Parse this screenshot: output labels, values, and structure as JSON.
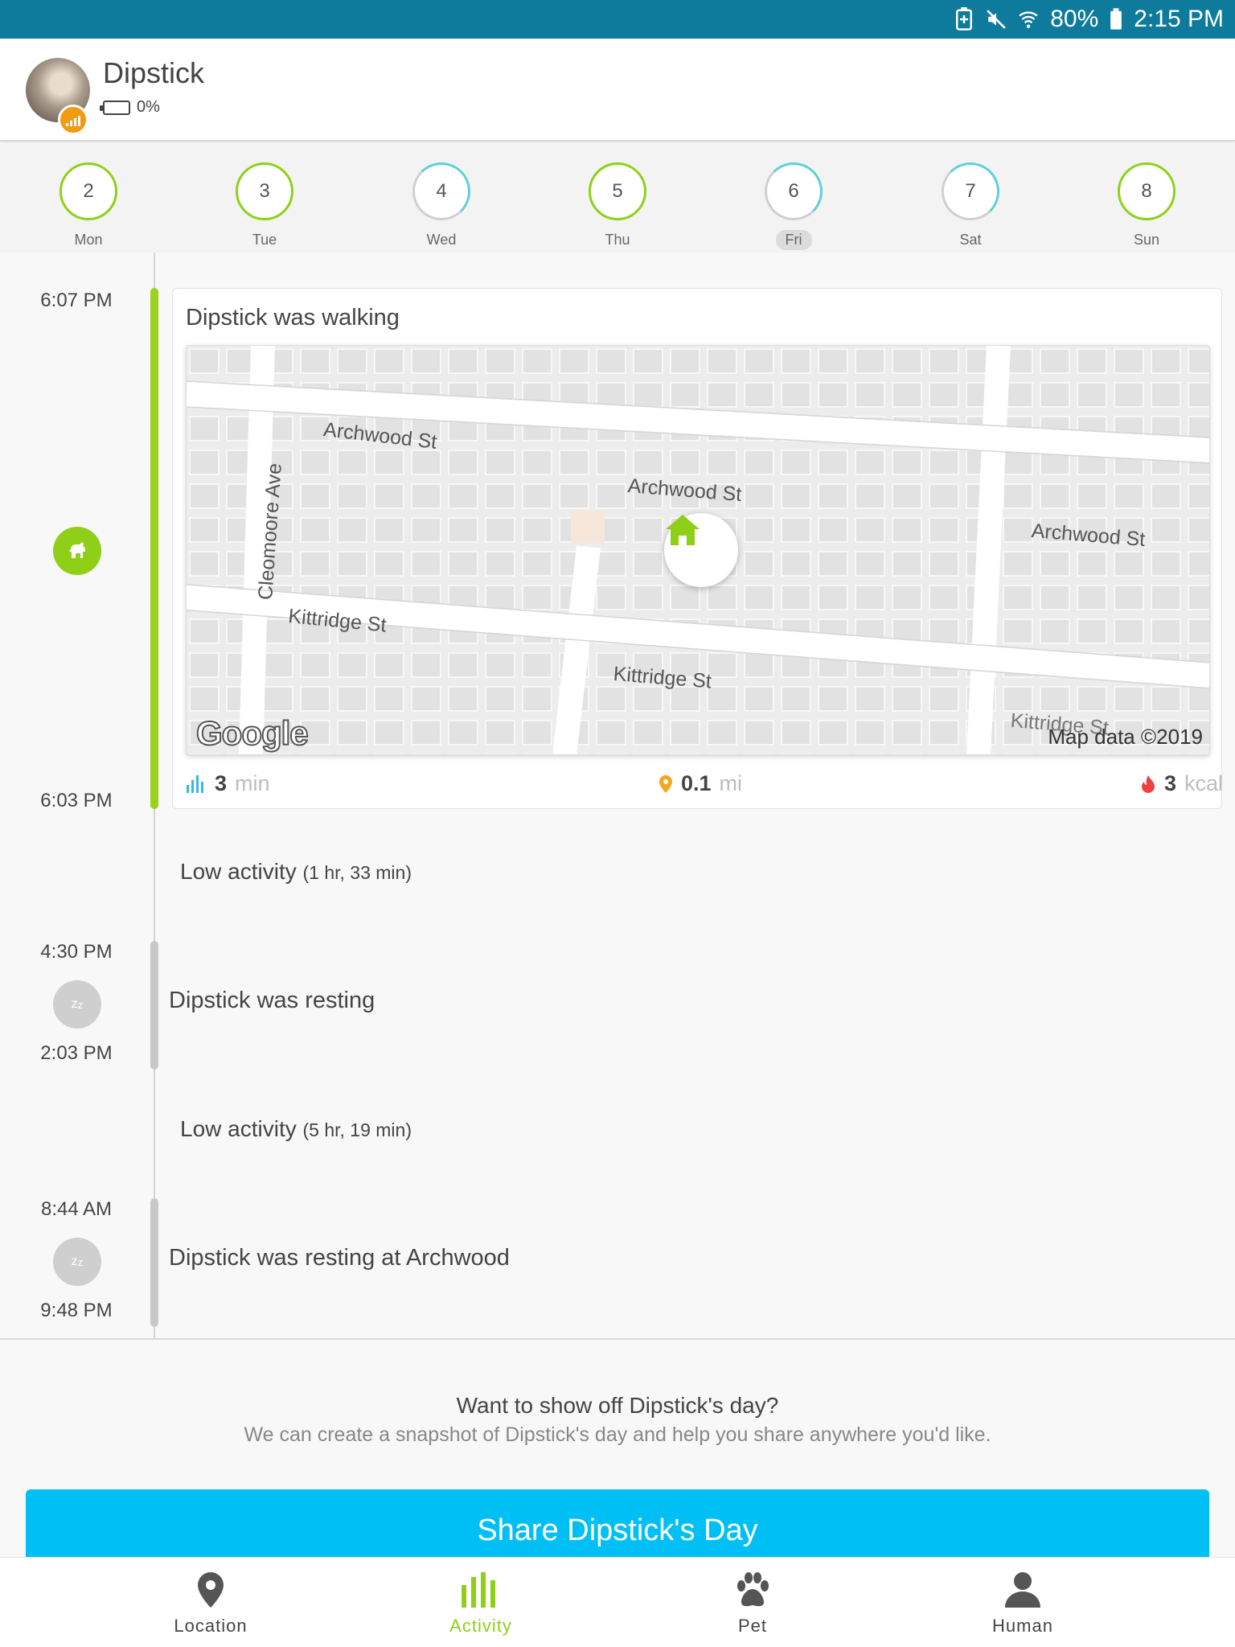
{
  "status_bar": {
    "battery": "80%",
    "time": "2:15 PM"
  },
  "pet": {
    "name": "Dipstick",
    "battery": "0%"
  },
  "days": [
    {
      "num": "2",
      "label": "Mon",
      "selected": false,
      "complete": true
    },
    {
      "num": "3",
      "label": "Tue",
      "selected": false,
      "complete": true
    },
    {
      "num": "4",
      "label": "Wed",
      "selected": false,
      "complete": false
    },
    {
      "num": "5",
      "label": "Thu",
      "selected": false,
      "complete": true
    },
    {
      "num": "6",
      "label": "Fri",
      "selected": true,
      "complete": false
    },
    {
      "num": "7",
      "label": "Sat",
      "selected": false,
      "complete": false
    },
    {
      "num": "8",
      "label": "Sun",
      "selected": false,
      "complete": true
    }
  ],
  "timeline": {
    "walk": {
      "start": "6:07 PM",
      "end": "6:03 PM",
      "title": "Dipstick was walking",
      "map": {
        "streets": [
          "Archwood St",
          "Archwood St",
          "Archwood St",
          "Cleomoore Ave",
          "Kittridge St",
          "Kittridge St",
          "Kittridge St"
        ],
        "logo": "Google",
        "attribution": "Map data ©2019"
      },
      "stats": {
        "duration": "3",
        "duration_unit": "min",
        "distance": "0.1",
        "distance_unit": "mi",
        "calories": "3",
        "calories_unit": "kcal"
      }
    },
    "low1": {
      "label": "Low activity",
      "duration": "(1 hr, 33 min)"
    },
    "rest1": {
      "start": "4:30 PM",
      "end": "2:03 PM",
      "title": "Dipstick was resting"
    },
    "low2": {
      "label": "Low activity",
      "duration": "(5 hr, 19 min)"
    },
    "rest2": {
      "start": "8:44 AM",
      "end": "9:48 PM",
      "title": "Dipstick was resting at Archwood"
    }
  },
  "share": {
    "question": "Want to show off Dipstick's day?",
    "description": "We can create a snapshot of Dipstick's day and help you share anywhere you'd like.",
    "button": "Share Dipstick's Day"
  },
  "nav": [
    {
      "label": "Location",
      "icon": "location-pin-icon",
      "active": false
    },
    {
      "label": "Activity",
      "icon": "activity-bars-icon",
      "active": true
    },
    {
      "label": "Pet",
      "icon": "paw-icon",
      "active": false
    },
    {
      "label": "Human",
      "icon": "person-icon",
      "active": false
    }
  ],
  "colors": {
    "accent_green": "#8fcf18",
    "share_blue": "#00bff5",
    "status_bar": "#0e7a9c",
    "rest_grey": "#c8c8c8"
  }
}
